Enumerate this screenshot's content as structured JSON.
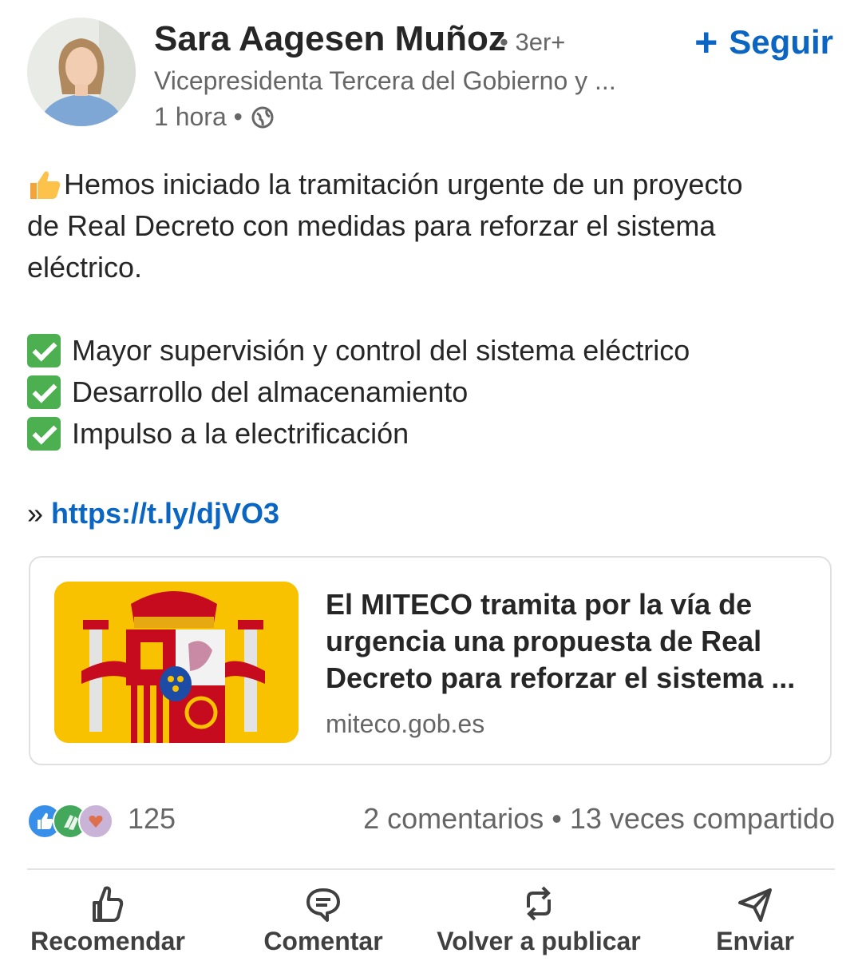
{
  "author": {
    "name": "Sara Aagesen Muñoz",
    "degree": "• 3er+",
    "headline": "Vicepresidenta Tercera del Gobierno y ...",
    "time": "1 hora •"
  },
  "follow": {
    "plus": "+",
    "label": "Seguir"
  },
  "post": {
    "intro_lines": [
      "Hemos iniciado la tramitación urgente de un proyecto",
      "de Real Decreto con medidas para reforzar el sistema",
      "eléctrico."
    ],
    "bullets": [
      "Mayor supervisión y control del sistema eléctrico",
      "Desarrollo del almacenamiento",
      "Impulso a la electrificación"
    ],
    "link_prefix": "»",
    "link": "https://t.ly/djVO3"
  },
  "card": {
    "title_lines": [
      "El MITECO tramita por la vía de",
      "urgencia una propuesta de Real",
      "Decreto para reforzar el sistema ..."
    ],
    "domain": "miteco.gob.es"
  },
  "social": {
    "reactions": "125",
    "counts": "2 comentarios • 13 veces compartido"
  },
  "actions": {
    "recommend": "Recomendar",
    "comment": "Comentar",
    "repost": "Volver a publicar",
    "send": "Enviar"
  },
  "colors": {
    "link_blue": "#0a66c2",
    "check_green": "#4caf50",
    "flag_yellow": "#f8c200",
    "flag_red": "#c60b1e"
  }
}
